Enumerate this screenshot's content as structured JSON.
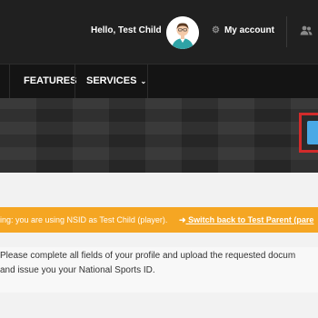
{
  "header": {
    "greeting": "Hello, Test Child",
    "account_label": "My account",
    "account_icon": "gear-icon",
    "extra_icon": "users-icon"
  },
  "nav": {
    "items": [
      {
        "label": "FEATURES"
      },
      {
        "label": "SERVICES",
        "icon": "chevron-down-icon"
      }
    ]
  },
  "hero": {
    "action_button_color": "#49a9e6",
    "highlight_color": "#d22b2b"
  },
  "warning": {
    "text": "ing: you are using NSID as Test Child (player).",
    "link_icon": "arrow-right-icon",
    "link_label": "Switch back to Test Parent (pare",
    "color": "#f5a623"
  },
  "notice": {
    "line1": "Please complete all fields of your profile and upload the requested docum",
    "line2": "and issue you your National Sports ID."
  },
  "colors": {
    "topbar": "#202020",
    "navbar": "#141414",
    "accent": "#f5a623"
  }
}
